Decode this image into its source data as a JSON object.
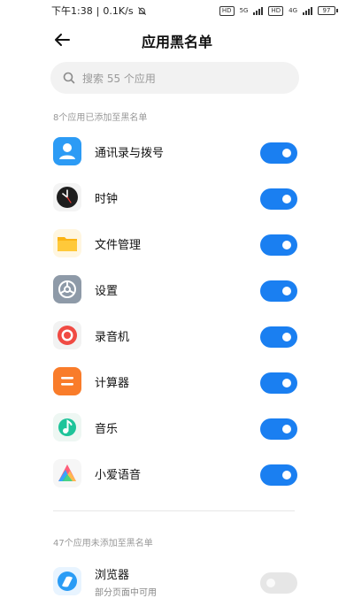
{
  "status_bar": {
    "time": "下午1:38",
    "speed": "0.1K/s",
    "sim1_badge": "HD",
    "sim1_network": "5G",
    "sim2_badge": "HD",
    "sim2_network": "4G",
    "battery": "97"
  },
  "header": {
    "title": "应用黑名单"
  },
  "search": {
    "placeholder": "搜索 55 个应用"
  },
  "blacklisted": {
    "label": "8个应用已添加至黑名单",
    "apps": [
      {
        "name": "通讯录与拨号",
        "icon": "contacts-icon",
        "enabled": true
      },
      {
        "name": "时钟",
        "icon": "clock-icon",
        "enabled": true
      },
      {
        "name": "文件管理",
        "icon": "folder-icon",
        "enabled": true
      },
      {
        "name": "设置",
        "icon": "settings-gear-icon",
        "enabled": true
      },
      {
        "name": "录音机",
        "icon": "recorder-icon",
        "enabled": true
      },
      {
        "name": "计算器",
        "icon": "calculator-icon",
        "enabled": true
      },
      {
        "name": "音乐",
        "icon": "music-icon",
        "enabled": true
      },
      {
        "name": "小爱语音",
        "icon": "xiaoai-voice-icon",
        "enabled": true
      }
    ]
  },
  "not_blacklisted": {
    "label": "47个应用未添加至黑名单",
    "apps": [
      {
        "name": "浏览器",
        "subtitle": "部分页面中可用",
        "icon": "browser-icon",
        "enabled": false
      }
    ]
  },
  "colors": {
    "toggle_on": "#1a7ff1",
    "toggle_off": "#e6e6e6"
  }
}
